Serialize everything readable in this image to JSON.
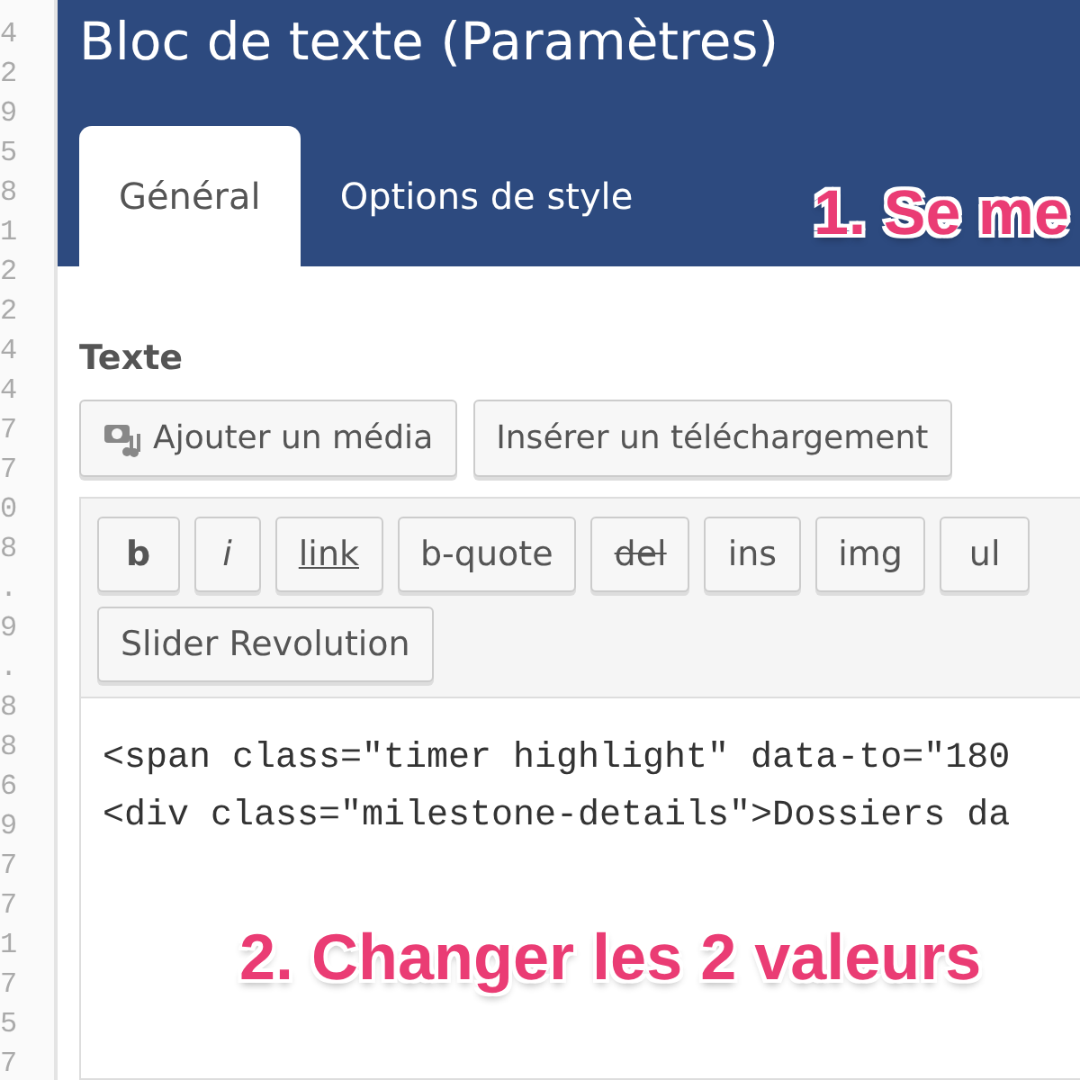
{
  "gutter_text": [
    "4",
    "2",
    "9",
    "5",
    "8",
    "1",
    "2",
    "2",
    "4",
    "4",
    "7",
    "7",
    "0",
    "8",
    ".",
    "9",
    ".",
    "8",
    "8",
    "6",
    "9",
    "7",
    "7",
    "1",
    "7",
    "5",
    "7"
  ],
  "dialog": {
    "title": "Bloc de texte (Paramètres)",
    "tabs": [
      {
        "label": "Général",
        "selected": true
      },
      {
        "label": "Options de style",
        "selected": false
      }
    ],
    "field_label": "Texte",
    "media_buttons": [
      {
        "label": "Ajouter un média",
        "kind": "media"
      },
      {
        "label": "Insérer un téléchargement",
        "kind": "plain"
      }
    ],
    "toolbar_rows": [
      [
        {
          "label": "b",
          "kind": "bold"
        },
        {
          "label": "i",
          "kind": "italic"
        },
        {
          "label": "link",
          "kind": "link"
        },
        {
          "label": "b-quote",
          "kind": "plain"
        },
        {
          "label": "del",
          "kind": "strike"
        },
        {
          "label": "ins",
          "kind": "plain"
        },
        {
          "label": "img",
          "kind": "plain"
        },
        {
          "label": "ul",
          "kind": "plain"
        }
      ],
      [
        {
          "label": "Slider Revolution",
          "kind": "plain"
        }
      ]
    ],
    "code_lines": [
      "<span class=\"timer highlight\" data-to=\"180",
      "<div class=\"milestone-details\">Dossiers da"
    ]
  },
  "header_annotation": "1. Se me",
  "editor_annotation": "2. Changer les 2 valeurs"
}
